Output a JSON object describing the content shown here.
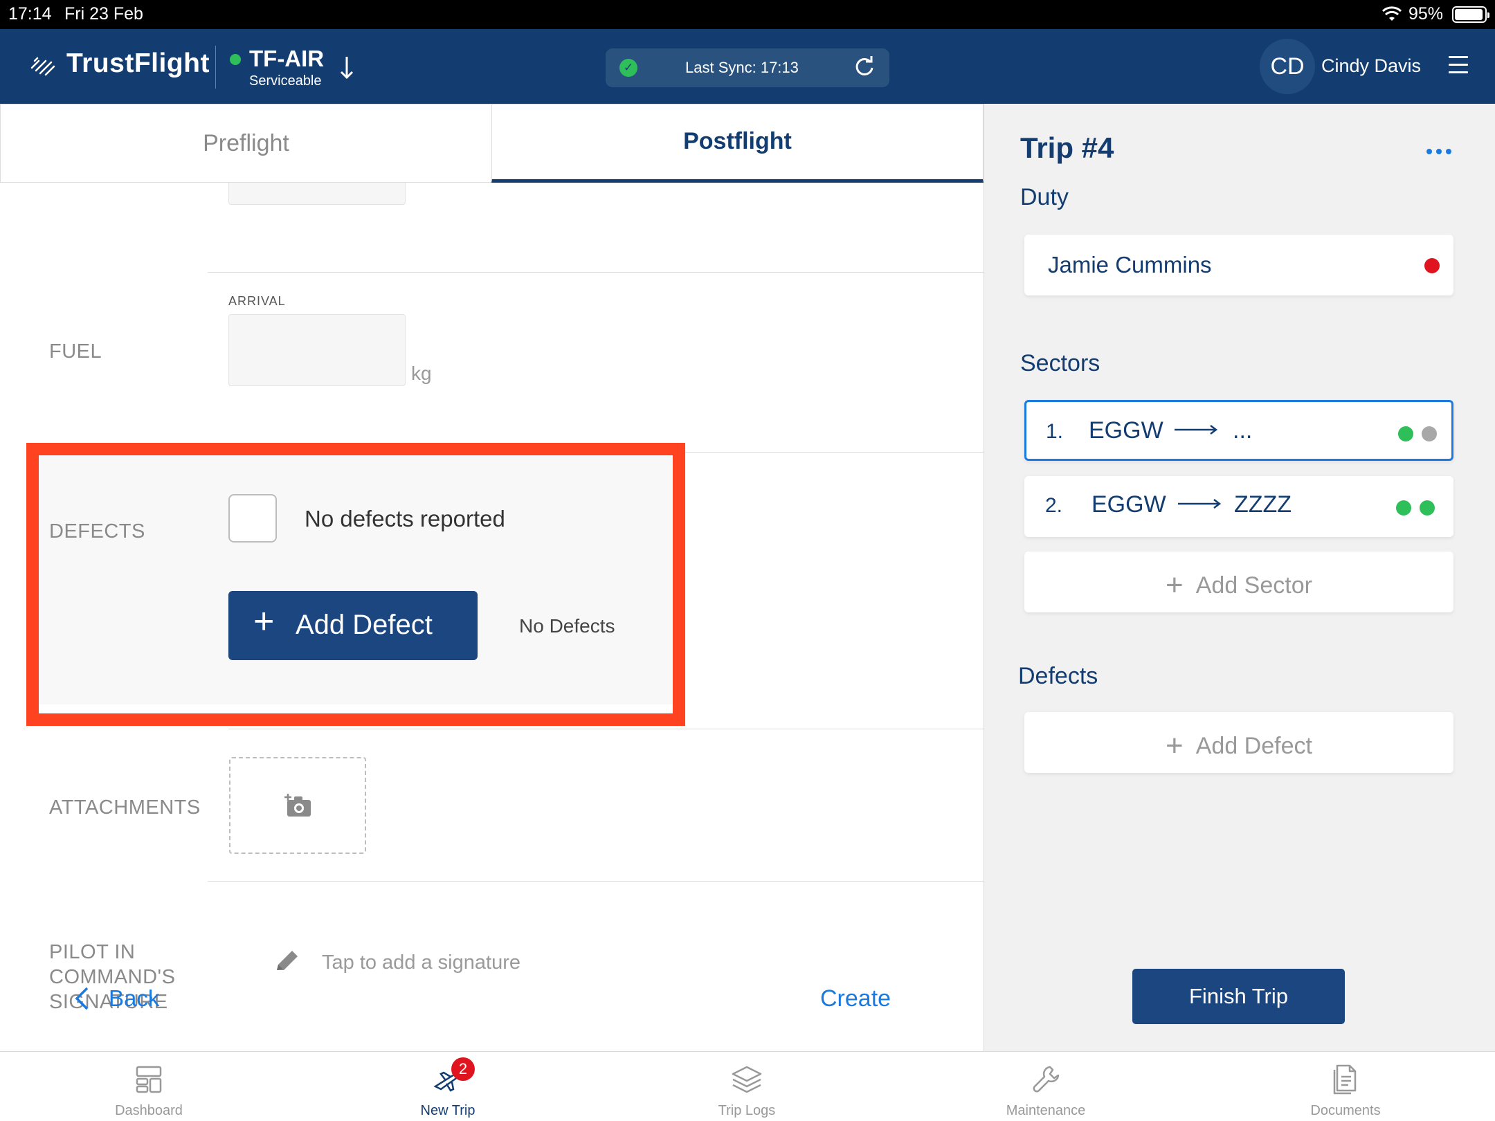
{
  "status_bar": {
    "time": "17:14",
    "date": "Fri 23 Feb",
    "battery": "95%"
  },
  "header": {
    "brand": "TrustFlight",
    "aircraft_registration": "TF-AIR",
    "aircraft_status": "Serviceable",
    "aircraft_toggle_icon": "arrow-down-icon",
    "sync_text": "Last Sync: 17:13",
    "user_initials": "CD",
    "user_name": "Cindy Davis",
    "colors": {
      "header_bg": "#133d70",
      "ok_green": "#2fbf5a"
    }
  },
  "tabs": [
    {
      "label": "Preflight",
      "active": false
    },
    {
      "label": "Postflight",
      "active": true
    }
  ],
  "form": {
    "fuel": {
      "label": "FUEL",
      "sub_label": "ARRIVAL",
      "value": "",
      "unit": "kg"
    },
    "defects": {
      "label": "DEFECTS",
      "checkbox_label": "No defects reported",
      "checked": false,
      "add_button_label": "Add Defect",
      "status_text": "No Defects"
    },
    "attachments": {
      "label": "ATTACHMENTS",
      "icon": "add-photo-icon"
    },
    "signature": {
      "label_line1": "PILOT IN",
      "label_line2": "COMMAND'S",
      "label_line3": "SIGNATURE",
      "placeholder": "Tap to add a signature"
    },
    "back_label": "Back",
    "create_label": "Create",
    "highlight_color": "#ff421f"
  },
  "trip_panel": {
    "title": "Trip #4",
    "duty": {
      "title": "Duty",
      "crew_name": "Jamie Cummins",
      "status_color": "#e0141e"
    },
    "sectors": {
      "title": "Sectors",
      "items": [
        {
          "number": "1.",
          "from": "EGGW",
          "to": "...",
          "selected": true,
          "dots": [
            "#2fbf5a",
            "#a8a8a8"
          ]
        },
        {
          "number": "2.",
          "from": "EGGW",
          "to": "ZZZZ",
          "selected": false,
          "dots": [
            "#2fbf5a",
            "#2fbf5a"
          ]
        }
      ],
      "add_label": "Add Sector"
    },
    "defects": {
      "title": "Defects",
      "add_label": "Add Defect"
    },
    "finish_label": "Finish Trip"
  },
  "tabbar": {
    "items": [
      {
        "label": "Dashboard",
        "icon": "dashboard-icon",
        "active": false
      },
      {
        "label": "New Trip",
        "icon": "new-trip-icon",
        "active": true,
        "badge": "2"
      },
      {
        "label": "Trip Logs",
        "icon": "trip-logs-icon",
        "active": false
      },
      {
        "label": "Maintenance",
        "icon": "maintenance-icon",
        "active": false
      },
      {
        "label": "Documents",
        "icon": "documents-icon",
        "active": false
      }
    ]
  }
}
